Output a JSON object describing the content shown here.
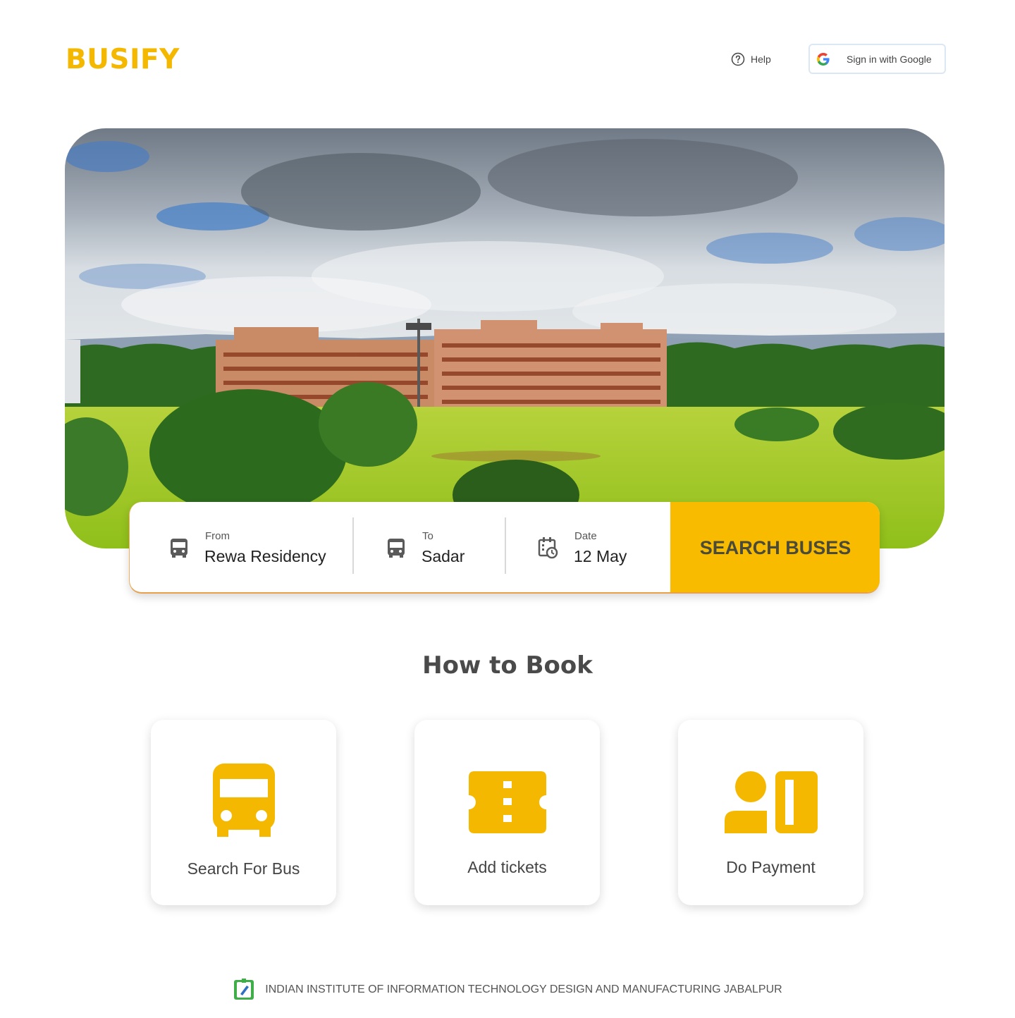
{
  "header": {
    "logo": "BUSIFY",
    "help_label": "Help",
    "signin_label": "Sign in with Google"
  },
  "search": {
    "from_label": "From",
    "from_value": "Rewa Residency",
    "to_label": "To",
    "to_value": "Sadar",
    "date_label": "Date",
    "date_value": "12 May",
    "button_label": "SEARCH BUSES"
  },
  "how_to_book": {
    "title": "How to Book",
    "steps": [
      {
        "label": "Search For Bus",
        "icon": "bus-icon"
      },
      {
        "label": "Add tickets",
        "icon": "ticket-icon"
      },
      {
        "label": "Do Payment",
        "icon": "payment-icon"
      }
    ]
  },
  "footer": {
    "text": "INDIAN INSTITUTE OF INFORMATION TECHNOLOGY DESIGN AND MANUFACTURING JABALPUR"
  },
  "colors": {
    "brand": "#f5b800",
    "button": "#f8bb00",
    "icon_yellow": "#f5b800"
  }
}
